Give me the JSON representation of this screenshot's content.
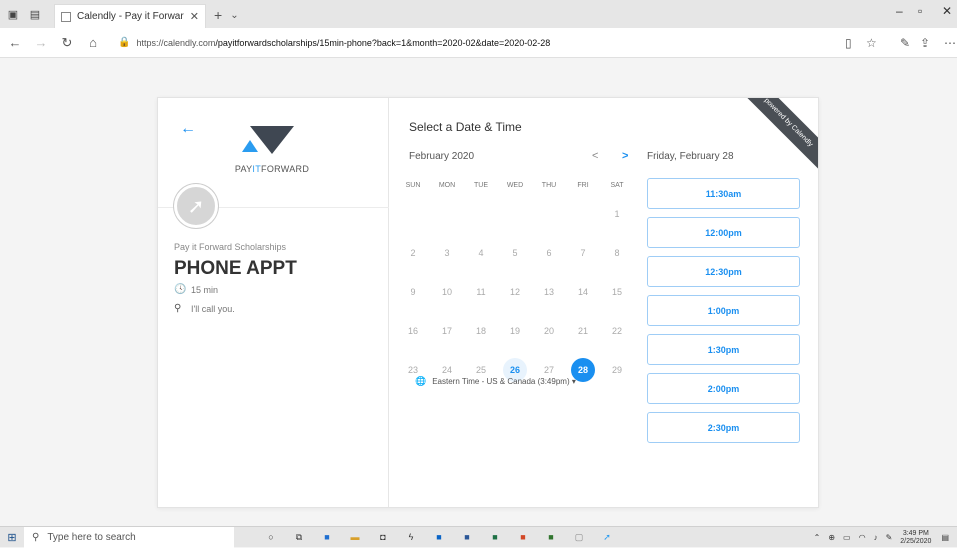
{
  "browser": {
    "tab_title": "Calendly - Pay it Forwar",
    "url_host": "https://calendly.com",
    "url_path": "/payitforwardscholarships/15min-phone?back=1&month=2020-02&date=2020-02-28"
  },
  "left": {
    "logo_text_a": "PAY",
    "logo_text_b": "IT",
    "logo_text_c": "FORWARD",
    "organizer": "Pay it Forward Scholarships",
    "event_name": "PHONE APPT",
    "duration": "15 min",
    "location": "I'll call you."
  },
  "calendar": {
    "heading": "Select a Date & Time",
    "month": "February 2020",
    "prev_label": "<",
    "next_label": ">",
    "weekdays": [
      "SUN",
      "MON",
      "TUE",
      "WED",
      "THU",
      "FRI",
      "SAT"
    ],
    "days": [
      {
        "d": "1",
        "state": "off",
        "col": 6,
        "row": 0
      },
      {
        "d": "2",
        "state": "off",
        "col": 0,
        "row": 1
      },
      {
        "d": "3",
        "state": "off",
        "col": 1,
        "row": 1
      },
      {
        "d": "4",
        "state": "off",
        "col": 2,
        "row": 1
      },
      {
        "d": "5",
        "state": "off",
        "col": 3,
        "row": 1
      },
      {
        "d": "6",
        "state": "off",
        "col": 4,
        "row": 1
      },
      {
        "d": "7",
        "state": "off",
        "col": 5,
        "row": 1
      },
      {
        "d": "8",
        "state": "off",
        "col": 6,
        "row": 1
      },
      {
        "d": "9",
        "state": "off",
        "col": 0,
        "row": 2
      },
      {
        "d": "10",
        "state": "off",
        "col": 1,
        "row": 2
      },
      {
        "d": "11",
        "state": "off",
        "col": 2,
        "row": 2
      },
      {
        "d": "12",
        "state": "off",
        "col": 3,
        "row": 2
      },
      {
        "d": "13",
        "state": "off",
        "col": 4,
        "row": 2
      },
      {
        "d": "14",
        "state": "off",
        "col": 5,
        "row": 2
      },
      {
        "d": "15",
        "state": "off",
        "col": 6,
        "row": 2
      },
      {
        "d": "16",
        "state": "off",
        "col": 0,
        "row": 3
      },
      {
        "d": "17",
        "state": "off",
        "col": 1,
        "row": 3
      },
      {
        "d": "18",
        "state": "off",
        "col": 2,
        "row": 3
      },
      {
        "d": "19",
        "state": "off",
        "col": 3,
        "row": 3
      },
      {
        "d": "20",
        "state": "off",
        "col": 4,
        "row": 3
      },
      {
        "d": "21",
        "state": "off",
        "col": 5,
        "row": 3
      },
      {
        "d": "22",
        "state": "off",
        "col": 6,
        "row": 3
      },
      {
        "d": "23",
        "state": "off",
        "col": 0,
        "row": 4
      },
      {
        "d": "24",
        "state": "off",
        "col": 1,
        "row": 4
      },
      {
        "d": "25",
        "state": "off",
        "col": 2,
        "row": 4
      },
      {
        "d": "26",
        "state": "avail",
        "col": 3,
        "row": 4
      },
      {
        "d": "27",
        "state": "off",
        "col": 4,
        "row": 4
      },
      {
        "d": "28",
        "state": "sel",
        "col": 5,
        "row": 4
      },
      {
        "d": "29",
        "state": "off",
        "col": 6,
        "row": 4
      }
    ],
    "timezone": "Eastern Time - US & Canada (3:49pm) ▾"
  },
  "slots": {
    "date_heading": "Friday, February 28",
    "times": [
      "11:30am",
      "12:00pm",
      "12:30pm",
      "1:00pm",
      "1:30pm",
      "2:00pm",
      "2:30pm"
    ]
  },
  "ribbon": "powered by Calendly",
  "taskbar": {
    "search_placeholder": "Type here to search",
    "time": "3:49 PM",
    "date": "2/25/2020"
  },
  "colors": {
    "accent": "#1a8ff0",
    "ribbon": "#4a4f55"
  }
}
